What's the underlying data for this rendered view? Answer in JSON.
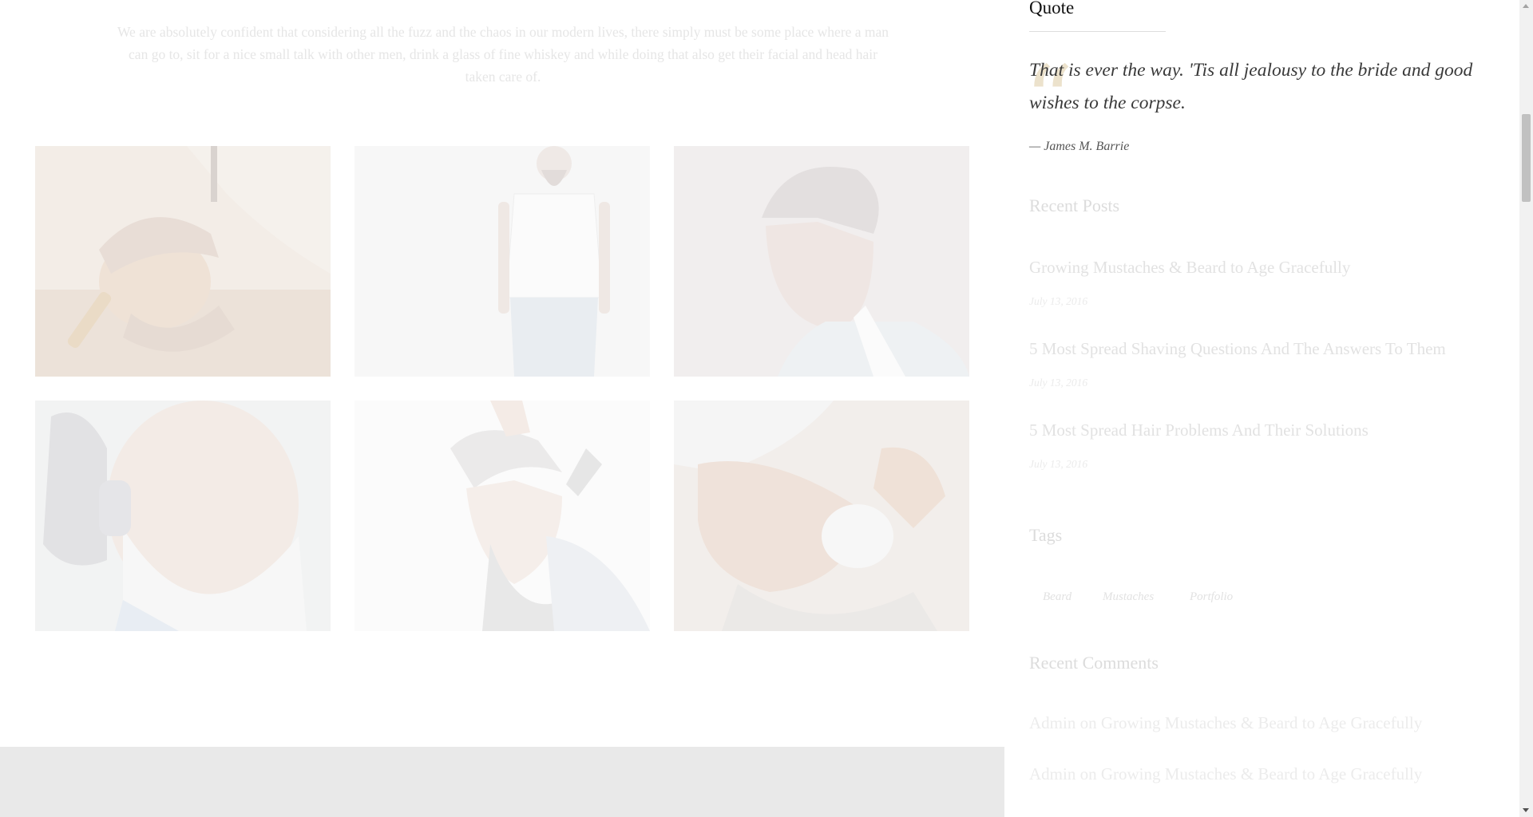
{
  "intro": {
    "text": "We are absolutely confident that considering all the fuzz and the chaos in our modern lives, there simply must be some place where a man can go to, sit for a nice small talk with other men, drink a glass of fine whiskey and while doing that also get their facial and head hair taken care of."
  },
  "gallery": {
    "items": [
      {
        "icon": "man-shaving-photo"
      },
      {
        "icon": "bearded-man-tshirt-photo"
      },
      {
        "icon": "man-profile-portrait-photo"
      },
      {
        "icon": "elderly-bearded-man-photo"
      },
      {
        "icon": "bearded-man-haircut-photo"
      },
      {
        "icon": "man-shaving-foam-photo"
      }
    ]
  },
  "sidebar": {
    "quote": {
      "heading": "Quote",
      "mark": "“",
      "text": "That is ever the way. 'Tis all jealousy to the bride and good wishes to the corpse.",
      "author": "— James M. Barrie"
    },
    "recent_posts": {
      "title": "Recent Posts",
      "items": [
        {
          "title": "Growing Mustaches & Beard to Age Gracefully",
          "date": "July 13, 2016"
        },
        {
          "title": "5 Most Spread Shaving Questions And The Answers To Them",
          "date": "July 13, 2016"
        },
        {
          "title": "5 Most Spread Hair Problems And Their Solutions",
          "date": "July 13, 2016"
        }
      ]
    },
    "tags": {
      "title": "Tags",
      "items": [
        "Beard",
        "Mustaches",
        "Portfolio"
      ]
    },
    "recent_comments": {
      "title": "Recent Comments",
      "items": [
        {
          "author": "Admin",
          "on": "on",
          "post": "Growing Mustaches & Beard to Age Gracefully"
        },
        {
          "author": "Admin",
          "on": "on",
          "post": "Growing Mustaches & Beard to Age Gracefully"
        }
      ]
    }
  },
  "colors": {
    "quote_accent": "#ece2cc",
    "faded_text": "#e2e2e2",
    "footer_band": "#e9e9e9"
  }
}
